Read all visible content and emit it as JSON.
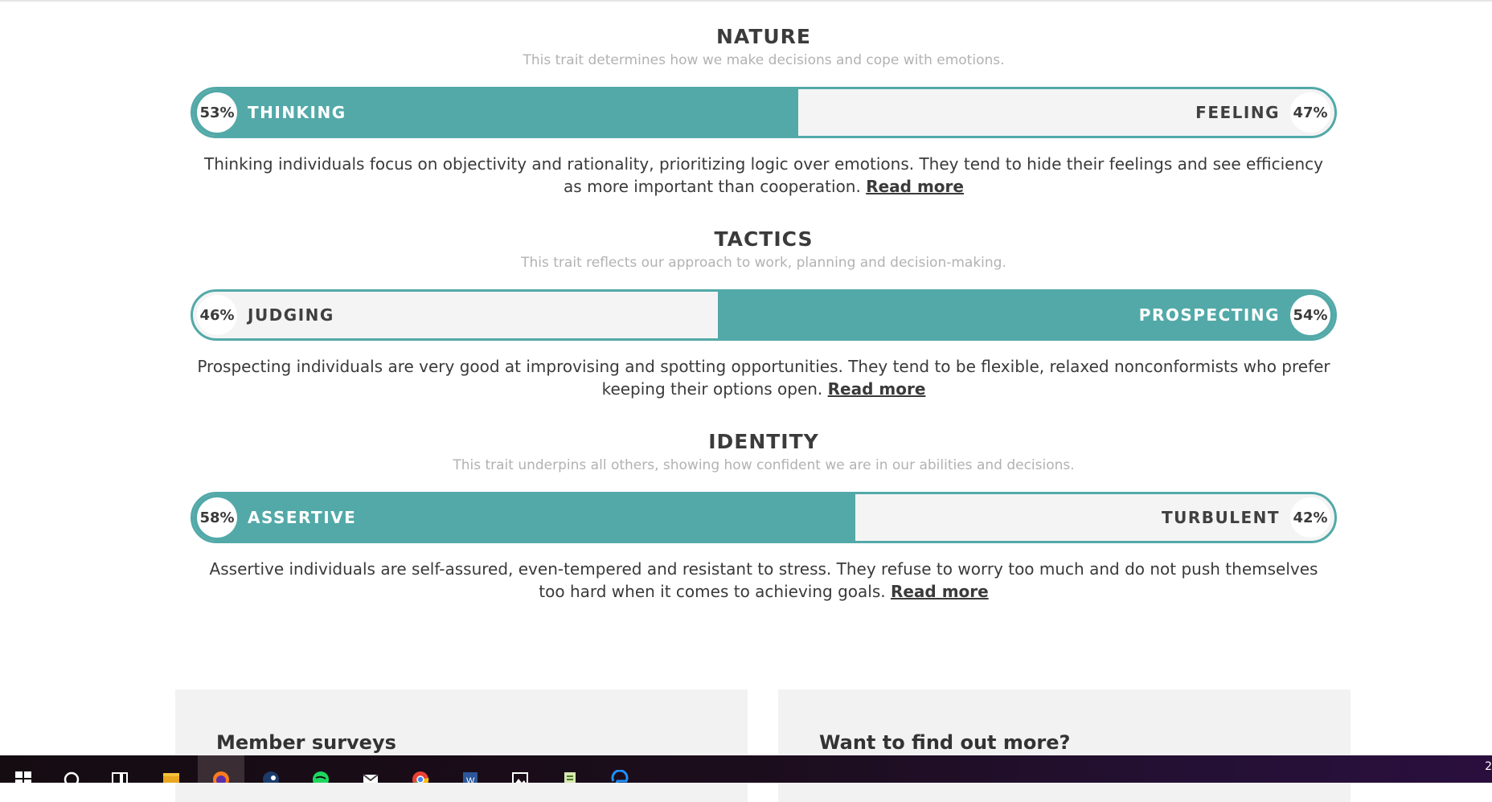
{
  "traits": [
    {
      "title": "NATURE",
      "subtitle": "This trait determines how we make decisions and cope with emotions.",
      "left": {
        "percent": "53%",
        "label": "THINKING"
      },
      "right": {
        "percent": "47%",
        "label": "FEELING"
      },
      "dominant": "left",
      "dominant_fraction": 0.53,
      "description": "Thinking individuals focus on objectivity and rationality, prioritizing logic over emotions. They tend to hide their feelings and see efficiency as more important than cooperation. ",
      "read_more": "Read more"
    },
    {
      "title": "TACTICS",
      "subtitle": "This trait reflects our approach to work, planning and decision-making.",
      "left": {
        "percent": "46%",
        "label": "JUDGING"
      },
      "right": {
        "percent": "54%",
        "label": "PROSPECTING"
      },
      "dominant": "right",
      "dominant_fraction": 0.54,
      "description": "Prospecting individuals are very good at improvising and spotting opportunities. They tend to be flexible, relaxed nonconformists who prefer keeping their options open. ",
      "read_more": "Read more"
    },
    {
      "title": "IDENTITY",
      "subtitle": "This trait underpins all others, showing how confident we are in our abilities and decisions.",
      "left": {
        "percent": "58%",
        "label": "ASSERTIVE"
      },
      "right": {
        "percent": "42%",
        "label": "TURBULENT"
      },
      "dominant": "left",
      "dominant_fraction": 0.58,
      "description": "Assertive individuals are self-assured, even-tempered and resistant to stress. They refuse to worry too much and do not push themselves too hard when it comes to achieving goals. ",
      "read_more": "Read more"
    }
  ],
  "cards": {
    "left_title": "Member surveys",
    "right_title": "Want to find out more?"
  },
  "taskbar": {
    "icons": [
      "windows-start-icon",
      "cortana-search-icon",
      "task-view-icon",
      "file-explorer-icon",
      "firefox-icon",
      "steam-icon",
      "spotify-icon",
      "mail-icon",
      "chrome-icon",
      "word-icon",
      "photos-icon",
      "notepad-icon",
      "edge-icon"
    ],
    "clock_partial": "2",
    "accent": "#52a9a8"
  }
}
